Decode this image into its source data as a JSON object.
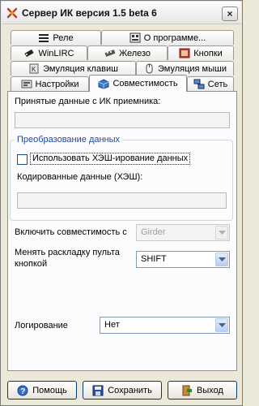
{
  "window": {
    "title": "Сервер ИК версия 1.5 beta 6",
    "close_label": "×"
  },
  "tabs": {
    "row1": [
      {
        "label": "Реле",
        "icon": "relay-icon"
      },
      {
        "label": "О программе...",
        "icon": "about-icon"
      }
    ],
    "row2": [
      {
        "label": "WinLIRC",
        "icon": "winlirc-icon"
      },
      {
        "label": "Железо",
        "icon": "hardware-icon"
      },
      {
        "label": "Кнопки",
        "icon": "buttons-icon"
      }
    ],
    "row3": [
      {
        "label": "Эмуляция клавиш",
        "icon": "keyboard-icon"
      },
      {
        "label": "Эмуляция мыши",
        "icon": "mouse-icon"
      }
    ],
    "row4": [
      {
        "label": "Настройки",
        "icon": "settings-icon"
      },
      {
        "label": "Совместимость",
        "icon": "compatibility-icon",
        "active": true
      },
      {
        "label": "Сеть",
        "icon": "network-icon"
      }
    ]
  },
  "panel": {
    "received_label": "Принятые данные с ИК приемника:",
    "received_value": "",
    "group_caption": "Преобразование данных",
    "hash_checkbox_label": "Использовать ХЭШ-ирование данных",
    "hash_checked": false,
    "encoded_label": "Кодированные данные (ХЭШ):",
    "encoded_value": "",
    "compat_label": "Включить совместимость с",
    "compat_value": "Girder",
    "layout_label_line1": "Менять раскладку пульта",
    "layout_label_line2": "кнопкой",
    "layout_value": "SHIFT",
    "logging_label": "Логирование",
    "logging_value": "Нет"
  },
  "buttons": {
    "help": "Помощь",
    "save": "Сохранить",
    "exit": "Выход"
  },
  "colors": {
    "background": "#ece9d8",
    "panel": "#fcfcfe",
    "group_caption": "#1b49a8",
    "button_border": "#003c74"
  }
}
